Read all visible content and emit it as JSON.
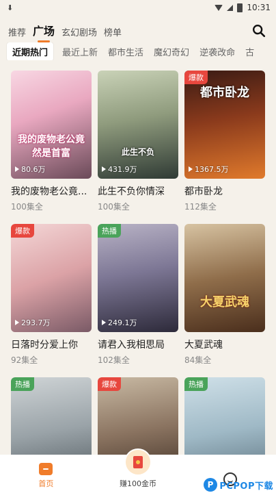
{
  "status_bar": {
    "time": "10:31"
  },
  "top_nav": {
    "tabs": [
      {
        "label": "推荐"
      },
      {
        "label": "广场"
      },
      {
        "label": "玄幻剧场"
      },
      {
        "label": "榜单"
      }
    ],
    "active_index": 1
  },
  "categories": [
    {
      "label": "近期热门"
    },
    {
      "label": "最近上新"
    },
    {
      "label": "都市生活"
    },
    {
      "label": "魔幻奇幻"
    },
    {
      "label": "逆袭改命"
    },
    {
      "label": "古"
    }
  ],
  "dramas": [
    {
      "title": "我的废物老公竟...",
      "episodes": "100集全",
      "views": "80.6万",
      "badge": "",
      "cover_text": "我的废物老公竟然是首富"
    },
    {
      "title": "此生不负你情深",
      "episodes": "100集全",
      "views": "431.9万",
      "badge": "",
      "cover_text": "此生不负"
    },
    {
      "title": "都市卧龙",
      "episodes": "112集全",
      "views": "1367.5万",
      "badge": "爆款",
      "cover_text": "都市卧龙"
    },
    {
      "title": "日落时分爱上你",
      "episodes": "92集全",
      "views": "293.7万",
      "badge": "爆款",
      "cover_text": ""
    },
    {
      "title": "请君入我相思局",
      "episodes": "102集全",
      "views": "249.1万",
      "badge": "热播",
      "cover_text": ""
    },
    {
      "title": "大夏武魂",
      "episodes": "84集全",
      "views": "",
      "badge": "",
      "cover_text": "大夏武魂"
    },
    {
      "title": "",
      "episodes": "",
      "views": "",
      "badge": "热播",
      "cover_text": ""
    },
    {
      "title": "",
      "episodes": "",
      "views": "",
      "badge": "爆款",
      "cover_text": ""
    },
    {
      "title": "",
      "episodes": "",
      "views": "",
      "badge": "热播",
      "cover_text": ""
    }
  ],
  "bottom_nav": {
    "home": "首页",
    "earn": "赚100金币",
    "me": ""
  },
  "watermark": {
    "text": "PCPOP下载"
  },
  "colors": {
    "accent": "#f07c2a",
    "badge_hot": "#e7473e",
    "badge_trend": "#4aa35a"
  }
}
